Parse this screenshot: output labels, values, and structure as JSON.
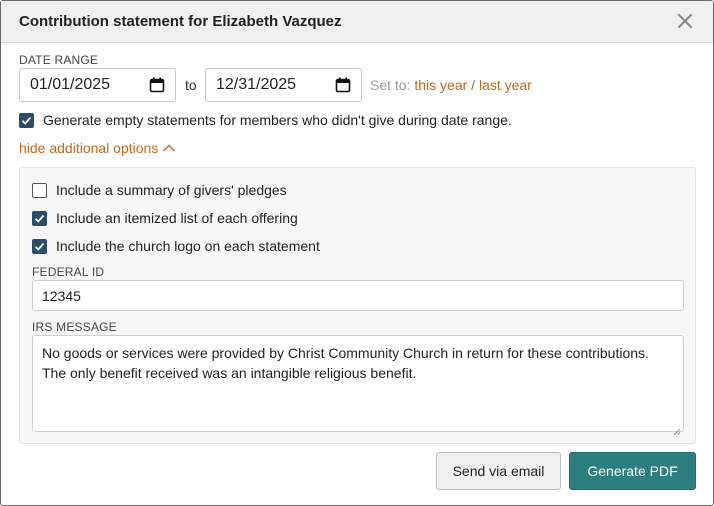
{
  "dialog": {
    "title": "Contribution statement for Elizabeth Vazquez"
  },
  "date_range": {
    "label": "DATE RANGE",
    "start": "01/01/2025",
    "to_label": "to",
    "end": "12/31/2025",
    "set_to_label": "Set to:",
    "this_year": "this year",
    "separator": "/",
    "last_year": "last year"
  },
  "generate_empty": {
    "checked": true,
    "label": "Generate empty statements for members who didn't give during date range."
  },
  "options_toggle": {
    "label": "hide additional options"
  },
  "options": {
    "pledges_summary": {
      "checked": false,
      "label": "Include a summary of givers' pledges"
    },
    "itemized_list": {
      "checked": true,
      "label": "Include an itemized list of each offering"
    },
    "church_logo": {
      "checked": true,
      "label": "Include the church logo on each statement"
    },
    "federal_id_label": "FEDERAL ID",
    "federal_id_value": "12345",
    "irs_label": "IRS MESSAGE",
    "irs_message": "No goods or services were provided by Christ Community Church in return for these contributions. The only benefit received was an intangible religious benefit."
  },
  "buttons": {
    "send_email": "Send via email",
    "generate_pdf": "Generate PDF"
  },
  "colors": {
    "link": "#c8661e",
    "checkbox": "#2b4c6b",
    "primary_button": "#2d7f7f"
  }
}
